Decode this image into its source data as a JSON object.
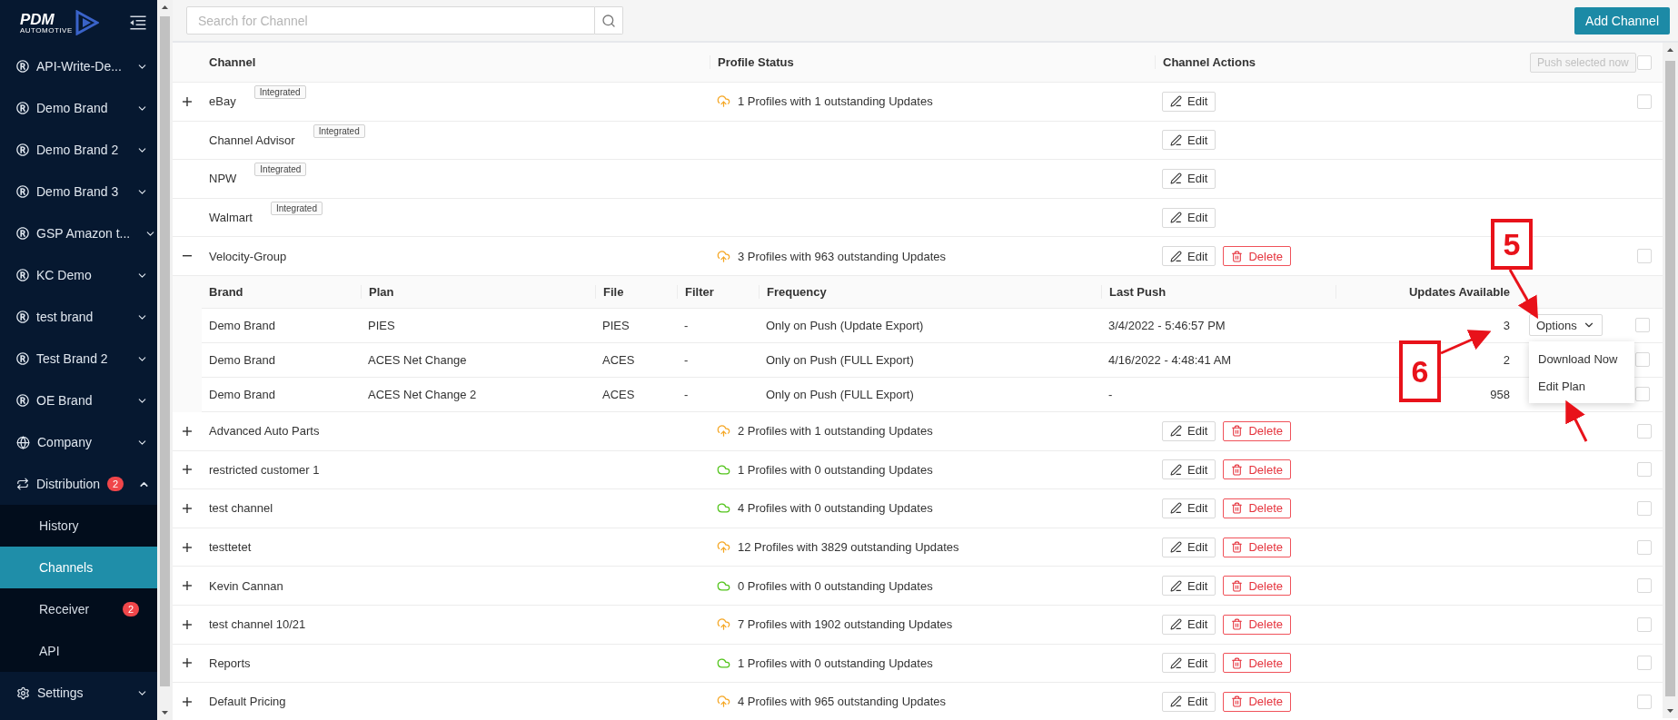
{
  "sidebar": {
    "logo": {
      "title": "PDM",
      "subtitle": "AUTOMOTIVE"
    },
    "items": [
      {
        "label": "API-Write-De...",
        "kind": "brand",
        "expanded": false
      },
      {
        "label": "Demo Brand",
        "kind": "brand",
        "expanded": false
      },
      {
        "label": "Demo Brand 2",
        "kind": "brand",
        "expanded": false
      },
      {
        "label": "Demo Brand 3",
        "kind": "brand",
        "expanded": false
      },
      {
        "label": "GSP Amazon t...",
        "kind": "brand",
        "expanded": false
      },
      {
        "label": "KC Demo",
        "kind": "brand",
        "expanded": false
      },
      {
        "label": "test brand",
        "kind": "brand",
        "expanded": false
      },
      {
        "label": "Test Brand 2",
        "kind": "brand",
        "expanded": false
      },
      {
        "label": "OE Brand",
        "kind": "brand",
        "expanded": false
      },
      {
        "label": "Company",
        "kind": "company",
        "expanded": false
      },
      {
        "label": "Distribution",
        "kind": "distribution",
        "expanded": true,
        "badge": "2",
        "children": [
          {
            "label": "History",
            "selected": false
          },
          {
            "label": "Channels",
            "selected": true
          },
          {
            "label": "Receiver",
            "selected": false,
            "badge": "2"
          },
          {
            "label": "API",
            "selected": false
          }
        ]
      },
      {
        "label": "Settings",
        "kind": "settings",
        "expanded": false
      }
    ]
  },
  "top_bar": {
    "search": {
      "placeholder": "Search for Channel"
    },
    "add_button": "Add Channel"
  },
  "table": {
    "columns": [
      "Channel",
      "Profile Status",
      "Channel Actions"
    ],
    "push_button": {
      "label": "Push selected now",
      "disabled": true
    },
    "header_checked": false,
    "rows": [
      {
        "name": "eBay",
        "tag": "Integrated",
        "expanded": false,
        "status": "1 Profiles with 1 outstanding Updates",
        "kind": "pending",
        "actions": [
          {
            "kind": "edit",
            "label": "Edit"
          }
        ],
        "checked": false
      },
      {
        "name": "Channel Advisor",
        "tag": "Integrated",
        "actions": [
          {
            "kind": "edit",
            "label": "Edit"
          }
        ]
      },
      {
        "name": "NPW",
        "tag": "Integrated",
        "actions": [
          {
            "kind": "edit",
            "label": "Edit"
          }
        ]
      },
      {
        "name": "Walmart",
        "tag": "Integrated",
        "actions": [
          {
            "kind": "edit",
            "label": "Edit"
          }
        ]
      },
      {
        "name": "Velocity-Group",
        "expanded": true,
        "status": "3 Profiles with 963 outstanding Updates",
        "kind": "pending",
        "actions": [
          {
            "kind": "edit",
            "label": "Edit"
          },
          {
            "kind": "delete",
            "label": "Delete"
          }
        ],
        "checked": false,
        "plans": {
          "columns": [
            "Brand",
            "Plan",
            "File",
            "Filter",
            "Frequency",
            "Last Push",
            "Updates Available"
          ],
          "rows": [
            {
              "brand": "Demo Brand",
              "plan": "PIES",
              "file": "PIES",
              "filter": "-",
              "frequency": "Only on Push (Update Export)",
              "last_push": "3/4/2022 - 5:46:57 PM",
              "updates": "3",
              "checked": false,
              "options": {
                "label": "Options",
                "menu": [
                  "Download Now",
                  "Edit Plan"
                ]
              }
            },
            {
              "brand": "Demo Brand",
              "plan": "ACES Net Change",
              "file": "ACES",
              "filter": "-",
              "frequency": "Only on Push (FULL Export)",
              "last_push": "4/16/2022 - 4:48:41 AM",
              "updates": "2",
              "checked": false
            },
            {
              "brand": "Demo Brand",
              "plan": "ACES Net Change 2",
              "file": "ACES",
              "filter": "-",
              "frequency": "Only on Push (FULL Export)",
              "last_push": "-",
              "updates": "958",
              "checked": false
            }
          ]
        }
      },
      {
        "name": "Advanced Auto Parts",
        "expanded": false,
        "status": "2 Profiles with 1 outstanding Updates",
        "kind": "pending",
        "actions": [
          {
            "kind": "edit",
            "label": "Edit"
          },
          {
            "kind": "delete",
            "label": "Delete"
          }
        ],
        "checked": false
      },
      {
        "name": "restricted customer 1",
        "expanded": false,
        "status": "1 Profiles with 0 outstanding Updates",
        "kind": "ok",
        "actions": [
          {
            "kind": "edit",
            "label": "Edit"
          },
          {
            "kind": "delete",
            "label": "Delete"
          }
        ],
        "checked": false
      },
      {
        "name": "test channel",
        "expanded": false,
        "status": "4 Profiles with 0 outstanding Updates",
        "kind": "ok",
        "actions": [
          {
            "kind": "edit",
            "label": "Edit"
          },
          {
            "kind": "delete",
            "label": "Delete"
          }
        ],
        "checked": false
      },
      {
        "name": "testtetet",
        "expanded": false,
        "status": "12 Profiles with 3829 outstanding Updates",
        "kind": "pending",
        "actions": [
          {
            "kind": "edit",
            "label": "Edit"
          },
          {
            "kind": "delete",
            "label": "Delete"
          }
        ],
        "checked": false
      },
      {
        "name": "Kevin Cannan",
        "expanded": false,
        "status": "0 Profiles with 0 outstanding Updates",
        "kind": "ok",
        "actions": [
          {
            "kind": "edit",
            "label": "Edit"
          },
          {
            "kind": "delete",
            "label": "Delete"
          }
        ],
        "checked": false
      },
      {
        "name": "test channel 10/21",
        "expanded": false,
        "status": "7 Profiles with 1902 outstanding Updates",
        "kind": "pending",
        "actions": [
          {
            "kind": "edit",
            "label": "Edit"
          },
          {
            "kind": "delete",
            "label": "Delete"
          }
        ],
        "checked": false
      },
      {
        "name": "Reports",
        "expanded": false,
        "status": "1 Profiles with 0 outstanding Updates",
        "kind": "ok",
        "actions": [
          {
            "kind": "edit",
            "label": "Edit"
          },
          {
            "kind": "delete",
            "label": "Delete"
          }
        ],
        "checked": false
      },
      {
        "name": "Default Pricing",
        "expanded": false,
        "status": "4 Profiles with 965 outstanding Updates",
        "kind": "pending",
        "actions": [
          {
            "kind": "edit",
            "label": "Edit"
          },
          {
            "kind": "delete",
            "label": "Delete"
          }
        ],
        "checked": false
      }
    ]
  },
  "callouts": [
    "5",
    "6"
  ]
}
